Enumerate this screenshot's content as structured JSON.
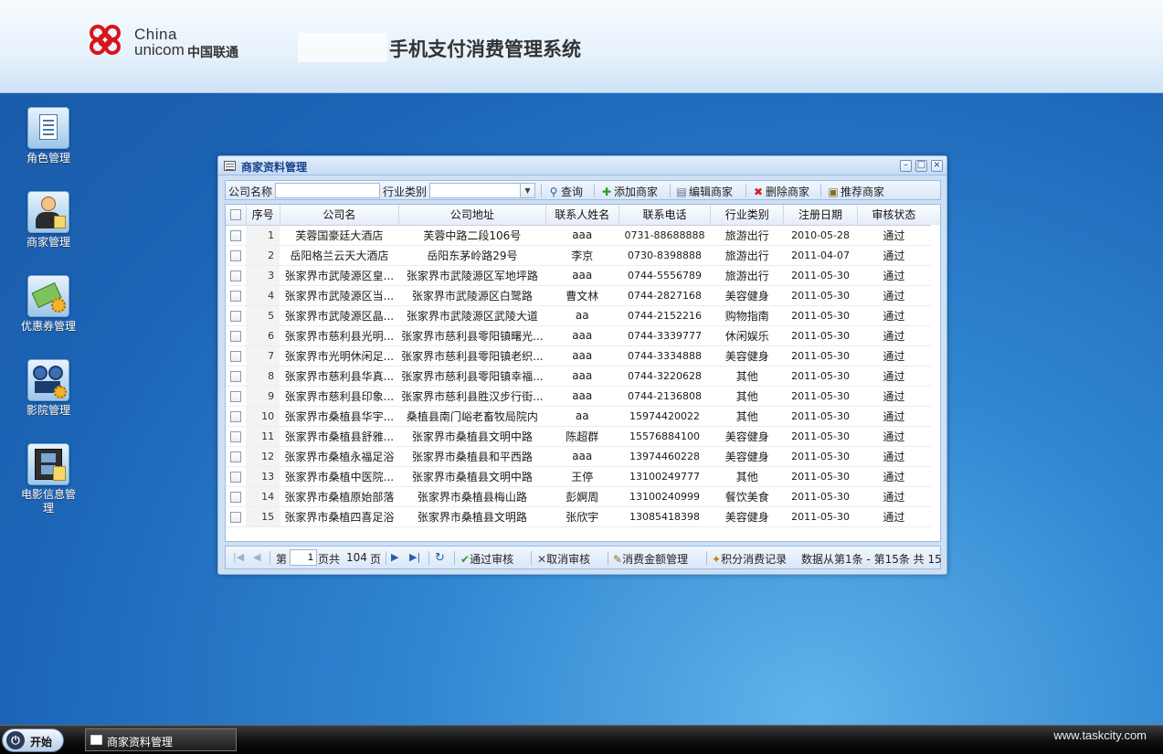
{
  "header": {
    "brand_en_1": "China",
    "brand_en_2": "unicom",
    "brand_cn": "中国联通",
    "system_title": "手机支付消费管理系统"
  },
  "desktop_icons": [
    {
      "label": "角色管理",
      "icon": "role-icon"
    },
    {
      "label": "商家管理",
      "icon": "merchant-icon"
    },
    {
      "label": "优惠券管理",
      "icon": "coupon-icon"
    },
    {
      "label": "影院管理",
      "icon": "cinema-icon"
    },
    {
      "label": "电影信息管理",
      "icon": "film-icon"
    }
  ],
  "window": {
    "title": "商家资料管理",
    "toolbar": {
      "company_name_label": "公司名称",
      "industry_label": "行业类别",
      "query": "查询",
      "add": "添加商家",
      "edit": "编辑商家",
      "delete": "删除商家",
      "recommend": "推荐商家"
    },
    "columns": [
      "序号",
      "公司名",
      "公司地址",
      "联系人姓名",
      "联系电话",
      "行业类别",
      "注册日期",
      "审核状态"
    ],
    "rows": [
      [
        "1",
        "芙蓉国豪廷大酒店",
        "芙蓉中路二段106号",
        "aaa",
        "0731-88688888",
        "旅游出行",
        "2010-05-28",
        "通过"
      ],
      [
        "2",
        "岳阳格兰云天大酒店",
        "岳阳东茅岭路29号",
        "李京",
        "0730-8398888",
        "旅游出行",
        "2011-04-07",
        "通过"
      ],
      [
        "3",
        "张家界市武陵源区皇...",
        "张家界市武陵源区军地坪路",
        "aaa",
        "0744-5556789",
        "旅游出行",
        "2011-05-30",
        "通过"
      ],
      [
        "4",
        "张家界市武陵源区当...",
        "张家界市武陵源区白鹭路",
        "曹文林",
        "0744-2827168",
        "美容健身",
        "2011-05-30",
        "通过"
      ],
      [
        "5",
        "张家界市武陵源区晶...",
        "张家界市武陵源区武陵大道",
        "aa",
        "0744-2152216",
        "购物指南",
        "2011-05-30",
        "通过"
      ],
      [
        "6",
        "张家界市慈利县光明...",
        "张家界市慈利县零阳镇曙光...",
        "aaa",
        "0744-3339777",
        "休闲娱乐",
        "2011-05-30",
        "通过"
      ],
      [
        "7",
        "张家界市光明休闲足...",
        "张家界市慈利县零阳镇老织...",
        "aaa",
        "0744-3334888",
        "美容健身",
        "2011-05-30",
        "通过"
      ],
      [
        "8",
        "张家界市慈利县华真...",
        "张家界市慈利县零阳镇幸福...",
        "aaa",
        "0744-3220628",
        "其他",
        "2011-05-30",
        "通过"
      ],
      [
        "9",
        "张家界市慈利县印象...",
        "张家界市慈利县胜汉步行街...",
        "aaa",
        "0744-2136808",
        "其他",
        "2011-05-30",
        "通过"
      ],
      [
        "10",
        "张家界市桑植县华宇...",
        "桑植县南门峪老畜牧局院内",
        "aa",
        "15974420022",
        "其他",
        "2011-05-30",
        "通过"
      ],
      [
        "11",
        "张家界市桑植县舒雅...",
        "张家界市桑植县文明中路",
        "陈超群",
        "15576884100",
        "美容健身",
        "2011-05-30",
        "通过"
      ],
      [
        "12",
        "张家界市桑植永福足浴",
        "张家界市桑植县和平西路",
        "aaa",
        "13974460228",
        "美容健身",
        "2011-05-30",
        "通过"
      ],
      [
        "13",
        "张家界市桑植中医院...",
        "张家界市桑植县文明中路",
        "王停",
        "13100249777",
        "其他",
        "2011-05-30",
        "通过"
      ],
      [
        "14",
        "张家界市桑植原始部落",
        "张家界市桑植县梅山路",
        "彭婀周",
        "13100240999",
        "餐饮美食",
        "2011-05-30",
        "通过"
      ],
      [
        "15",
        "张家界市桑植四喜足浴",
        "张家界市桑植县文明路",
        "张欣宇",
        "13085418398",
        "美容健身",
        "2011-05-30",
        "通过"
      ]
    ],
    "pager": {
      "page_prefix": "第",
      "current_page": "1",
      "page_mid": "页共",
      "total_pages": "104",
      "page_suffix": "页",
      "approve": "通过审核",
      "cancel_approve": "取消审核",
      "spend_amount": "消费金额管理",
      "points_record": "积分消费记录",
      "summary": "数据从第1条 - 第15条  共 15"
    }
  },
  "taskbar": {
    "start_label": "开始",
    "task_label": "商家资料管理"
  },
  "watermark": "www.taskcity.com"
}
